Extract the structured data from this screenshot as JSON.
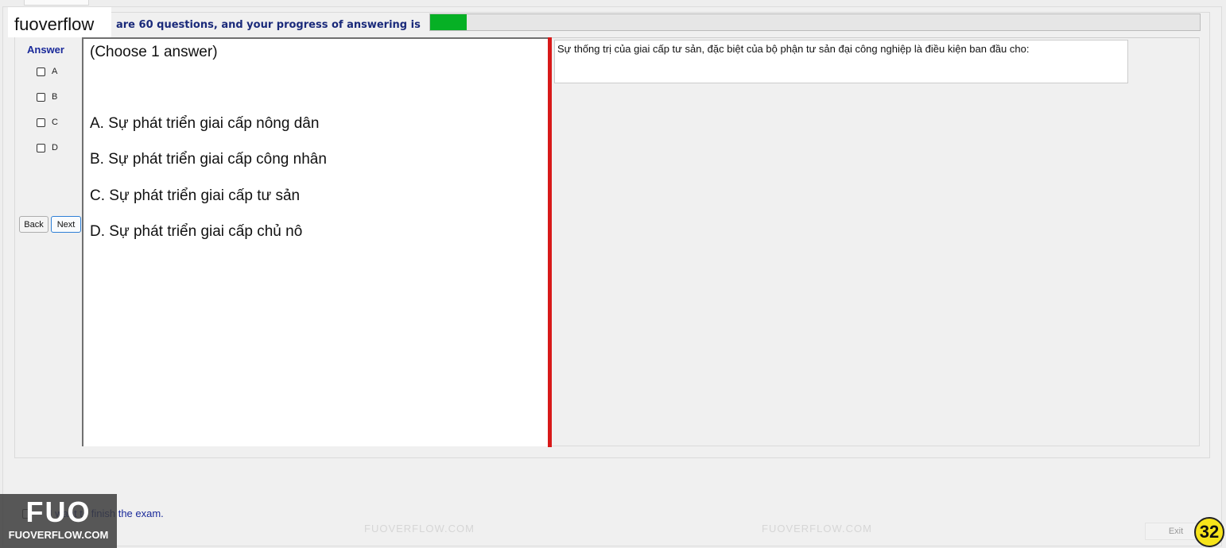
{
  "header": {
    "brand": "fuoverflow",
    "info_text": "are 60 questions, and your progress of answering is",
    "progress_fraction": 0.048
  },
  "answer_panel": {
    "title": "Answer",
    "options": [
      "A",
      "B",
      "C",
      "D"
    ],
    "back_label": "Back",
    "next_label": "Next"
  },
  "question": {
    "instruction": "(Choose 1 answer)",
    "options": [
      "A.  Sự phát triển giai cấp nông dân",
      "B.  Sự phát triển giai cấp công nhân",
      "C.  Sự phát triển giai cấp tư sản",
      "D.  Sự phát triển giai cấp chủ nô"
    ],
    "text": "Sự thống trị của giai cấp tư sản, đặc biệt của bộ phận tư sản đại công nghiệp là điều kiện ban đầu cho:"
  },
  "footer": {
    "finish_text": "I want to finish the exam.",
    "logo_big": "FUO",
    "logo_small": "FUOVERFLOW.COM",
    "exit_label": "Exit",
    "page_number": "32"
  },
  "watermark": "FUOVERFLOW.COM",
  "colors": {
    "progress": "#06b025",
    "divider": "#d81919",
    "label_blue": "#1a2a9a",
    "badge": "#f7e41a"
  }
}
